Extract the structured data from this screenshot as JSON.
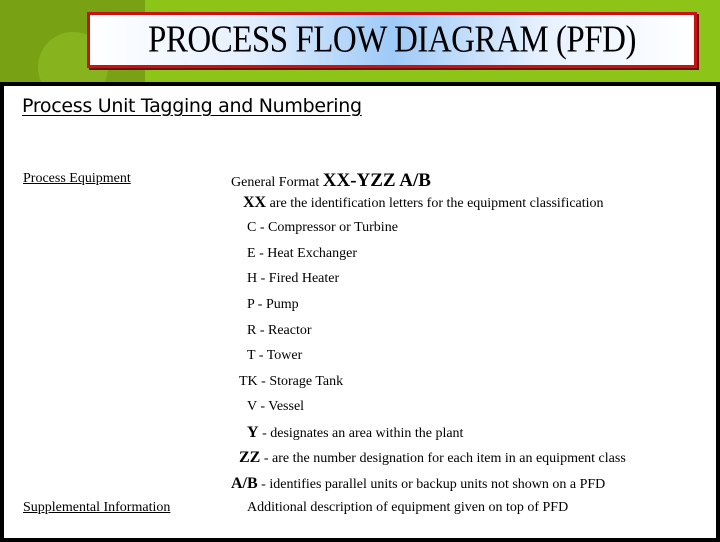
{
  "slide": {
    "title": "PROCESS FLOW DIAGRAM (PFD)",
    "heading": "Process Unit Tagging and Numbering",
    "left_labels": {
      "process_equipment": "Process Equipment",
      "supplemental_information": "Supplemental Information"
    },
    "general_format": {
      "label": "General Format",
      "format": "XX-YZZ A/B"
    },
    "xx_line": {
      "key": "XX",
      "text": "are the identification letters for the equipment classification"
    },
    "classifications": [
      {
        "code": "C",
        "text": "- Compressor or Turbine"
      },
      {
        "code": "E",
        "text": "- Heat Exchanger"
      },
      {
        "code": "H",
        "text": "- Fired Heater"
      },
      {
        "code": "P",
        "text": "- Pump"
      },
      {
        "code": "R",
        "text": "- Reactor"
      },
      {
        "code": "T",
        "text": "- Tower"
      },
      {
        "code": "TK",
        "text": "- Storage Tank"
      },
      {
        "code": "V",
        "text": "- Vessel"
      }
    ],
    "y_line": {
      "key": "Y",
      "text": "- designates an area within the plant"
    },
    "zz_line": {
      "key": "ZZ",
      "text": "- are the number designation for each item in an equipment class"
    },
    "ab_line": {
      "key": "A/B",
      "text": "-  identifies parallel units or backup units not shown on a PFD"
    },
    "supplemental_text": "Additional description of equipment given on top of PFD"
  },
  "colors": {
    "background_green": "#8cc418",
    "dark_green": "#78a214",
    "title_border": "#cc1111",
    "title_gradient_center": "#9fcaf7"
  }
}
